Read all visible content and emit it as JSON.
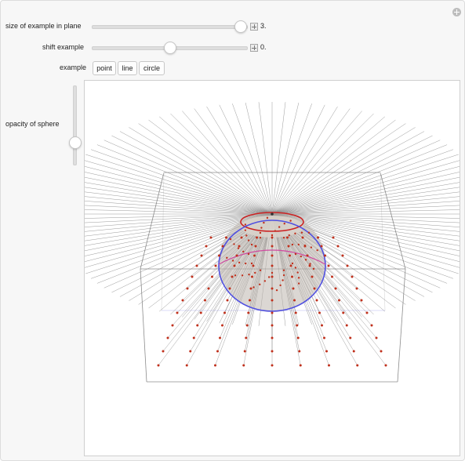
{
  "controls": {
    "size_label": "size of example in plane",
    "size_value": "3.",
    "size_level": 0.95,
    "shift_label": "shift example",
    "shift_value": "0.",
    "shift_level": 0.5,
    "example_label": "example",
    "example_options": [
      "point",
      "line",
      "circle"
    ],
    "opacity_label": "opacity of sphere",
    "opacity_level": 0.27
  },
  "colors": {
    "rays": "#7a7a7a",
    "dots": "#c0301c",
    "circle_top": "#cc2222",
    "circle_mid": "#5050e0",
    "sphere": "#bdb6ae",
    "box": "#8c8c8c"
  },
  "icons": {
    "panel_toggle": "plus-circle-icon",
    "size_stepper": "plus-square-icon",
    "shift_stepper": "plus-square-icon"
  }
}
